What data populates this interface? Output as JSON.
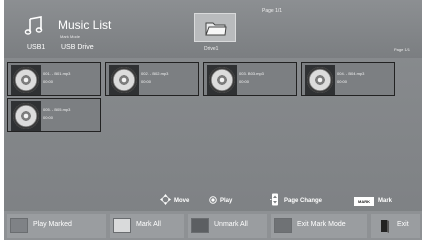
{
  "header": {
    "title": "Music List",
    "mode_label": "Mark Mode",
    "breadcrumb": [
      "USB1",
      "USB Drive"
    ],
    "folder_label": "Drive1",
    "page_top": "Page 1/1",
    "page_right": "Page 1/1"
  },
  "tracks": [
    {
      "name": "001. - B01.mp3",
      "duration": "00:00"
    },
    {
      "name": "002. - B02.mp3",
      "duration": "00:00"
    },
    {
      "name": "003. B03.mp3",
      "duration": "00:00"
    },
    {
      "name": "004. - B04.mp3",
      "duration": "00:00"
    },
    {
      "name": "005. - B05.mp3",
      "duration": "00:00"
    }
  ],
  "hints": {
    "move": "Move",
    "play": "Play",
    "page_change": "Page Change",
    "mark_badge": "MARK",
    "mark": "Mark"
  },
  "buttons": {
    "play_marked": "Play Marked",
    "mark_all": "Mark All",
    "unmark_all": "Unmark All",
    "exit_mark_mode": "Exit Mark Mode",
    "exit": "Exit"
  },
  "icons": {
    "title": "music-note-icon",
    "folder": "folder-icon",
    "track": "disc-icon",
    "move": "four-way-arrow-icon",
    "play": "ok-button-icon",
    "page_change": "page-up-down-icon",
    "exit": "door-icon"
  },
  "colors": {
    "screen_bg": "#8a8d90",
    "button_bg": "#9a9da0",
    "tile_border": "#222222",
    "text": "#ffffff"
  }
}
